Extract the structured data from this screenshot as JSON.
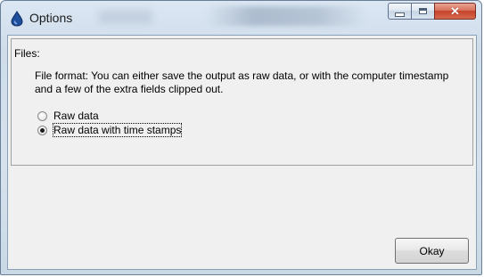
{
  "window": {
    "title": "Options"
  },
  "files_group": {
    "label": "Files:",
    "description": "File format:  You can either save the output as raw data, or with the computer timestamp and a few of the extra fields clipped out.",
    "options": [
      {
        "label": "Raw data",
        "checked": false
      },
      {
        "label": "Raw data with time stamps",
        "checked": true
      }
    ]
  },
  "buttons": {
    "okay": "Okay"
  }
}
